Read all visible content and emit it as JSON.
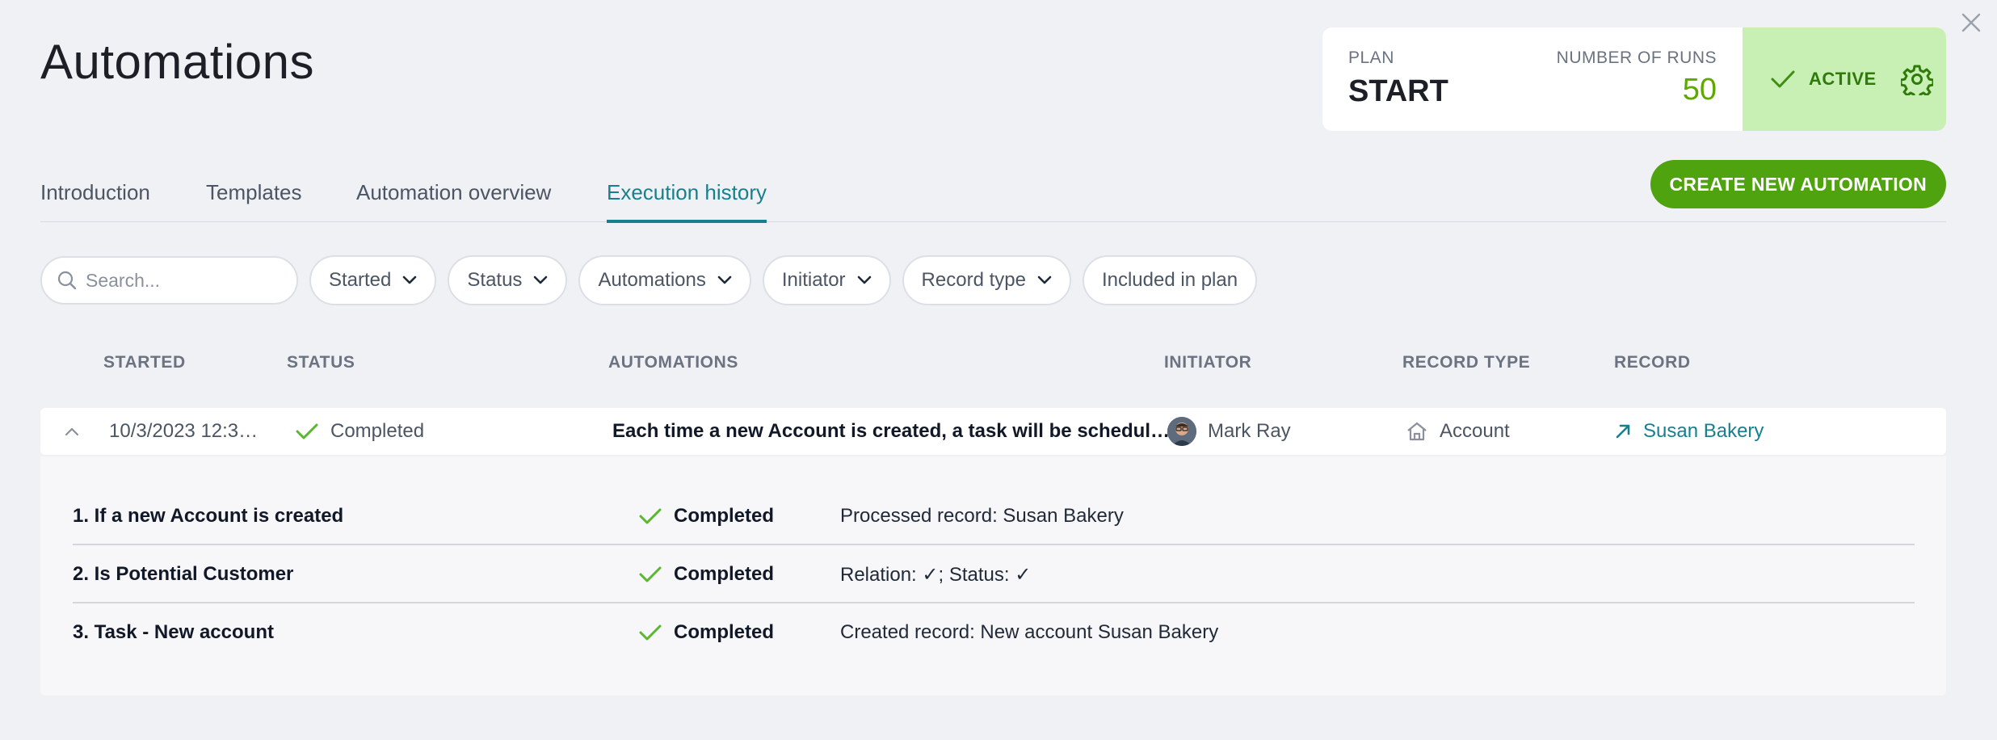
{
  "page": {
    "title": "Automations"
  },
  "plan": {
    "plan_label": "PLAN",
    "plan_value": "START",
    "runs_label": "NUMBER OF RUNS",
    "runs_value": "50",
    "status_label": "ACTIVE",
    "colors": {
      "active_bg": "#c8f0b4",
      "active_text": "#2f7a0a",
      "runs": "#5ea800"
    }
  },
  "tabs": [
    {
      "label": "Introduction",
      "active": false
    },
    {
      "label": "Templates",
      "active": false
    },
    {
      "label": "Automation overview",
      "active": false
    },
    {
      "label": "Execution history",
      "active": true
    }
  ],
  "actions": {
    "create_label": "CREATE NEW AUTOMATION"
  },
  "filters": {
    "search_placeholder": "Search...",
    "started": "Started",
    "status": "Status",
    "automations": "Automations",
    "initiator": "Initiator",
    "record_type": "Record type",
    "included": "Included in plan"
  },
  "table": {
    "headers": {
      "started": "STARTED",
      "status": "STATUS",
      "automations": "AUTOMATIONS",
      "initiator": "INITIATOR",
      "record_type": "RECORD TYPE",
      "record": "RECORD"
    },
    "row": {
      "started": "10/3/2023 12:3…",
      "status": "Completed",
      "automation": "Each time a new Account is created, a task will be schedul…",
      "initiator": "Mark Ray",
      "record_type": "Account",
      "record": "Susan Bakery"
    },
    "steps": [
      {
        "name": "1. If a new Account is created",
        "status": "Completed",
        "detail": "Processed record: Susan Bakery"
      },
      {
        "name": "2. Is Potential Customer",
        "status": "Completed",
        "detail": "Relation: ✓; Status: ✓"
      },
      {
        "name": "3. Task - New account",
        "status": "Completed",
        "detail": "Created record: New account Susan Bakery"
      }
    ]
  },
  "icons": {
    "close": "close-icon",
    "check": "check-icon",
    "gear": "gear-icon",
    "search": "search-icon",
    "chevron": "chevron-down-icon",
    "home": "home-icon",
    "link": "arrow-up-right-icon"
  }
}
